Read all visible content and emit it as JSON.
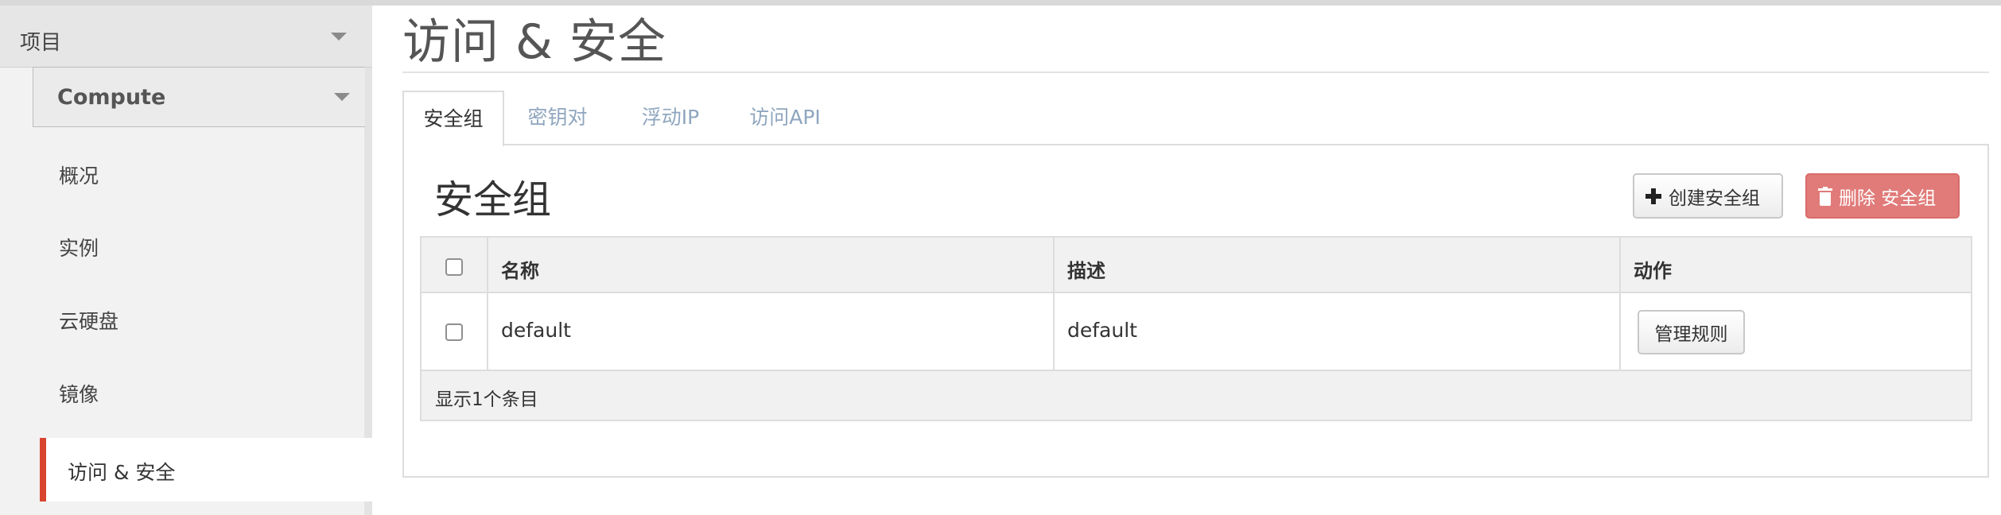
{
  "sidebar": {
    "header_label": "项目",
    "sub_header_label": "Compute",
    "items": [
      {
        "label": "概况"
      },
      {
        "label": "实例"
      },
      {
        "label": "云硬盘"
      },
      {
        "label": "镜像"
      },
      {
        "label": "访问 & 安全",
        "active": true
      }
    ]
  },
  "main": {
    "page_title": "访问 & 安全",
    "tabs": [
      {
        "label": "安全组",
        "active": true
      },
      {
        "label": "密钥对"
      },
      {
        "label": "浮动IP"
      },
      {
        "label": "访问API"
      }
    ],
    "section_title": "安全组",
    "buttons": {
      "create_label": "创建安全组",
      "create_icon": "plus-icon",
      "delete_label": "删除 安全组",
      "delete_icon": "trash-icon"
    },
    "table": {
      "columns": [
        "名称",
        "描述",
        "动作"
      ],
      "rows": [
        {
          "name": "default",
          "description": "default",
          "action_label": "管理规则"
        }
      ],
      "footer": "显示1个条目"
    }
  },
  "colors": {
    "active_indicator": "#d9442f",
    "danger_button": "#e07b79",
    "tab_link": "#8fa6bf"
  }
}
